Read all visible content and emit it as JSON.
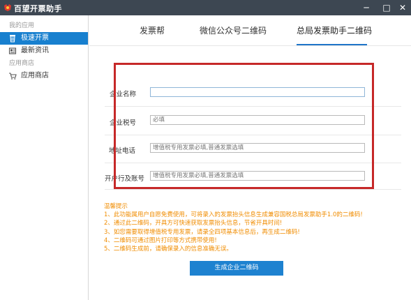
{
  "window": {
    "title": "百望开票助手",
    "minimize": "─",
    "maximize": "□",
    "close": "✕"
  },
  "sidebar": {
    "group_my_apps": "我的应用",
    "item_fast_invoice": "极速开票",
    "item_latest_news": "最新资讯",
    "group_app_store": "应用商店",
    "item_app_store": "应用商店"
  },
  "tabs": [
    "发票帮",
    "微信公众号二维码",
    "总局发票助手二维码"
  ],
  "form": {
    "company_name_label": "企业名称",
    "company_name_value": "",
    "tax_no_label": "企业税号",
    "tax_no_placeholder": "必填",
    "address_label": "地址电话",
    "address_placeholder": "增值税专用发票必填,普通发票选填",
    "bank_label": "开户行及账号",
    "bank_placeholder": "增值税专用发票必填,普通发票选填"
  },
  "tips": {
    "title": "温馨提示",
    "lines": [
      "1、此功能属用户自愿免费使用，可将录入的发票抬头信息生成兼容国税总局发票助手1.0的二维码!",
      "2、通过此二维码，开具方可快速获取发票抬头信息，节省开具时间!",
      "3、如您需要取得增值税专用发票，请录全四项基本信息后，再生成二维码!",
      "4、二维码可通过图片打印等方式携带使用!",
      "5、二维码生成前，请确保录入的信息准确无误。"
    ]
  },
  "generate_button": "生成企业二维码",
  "colors": {
    "titlebar": "#3d4752",
    "accent": "#1e82d0",
    "tips": "#f08c00",
    "highlight_box": "#c62828"
  }
}
